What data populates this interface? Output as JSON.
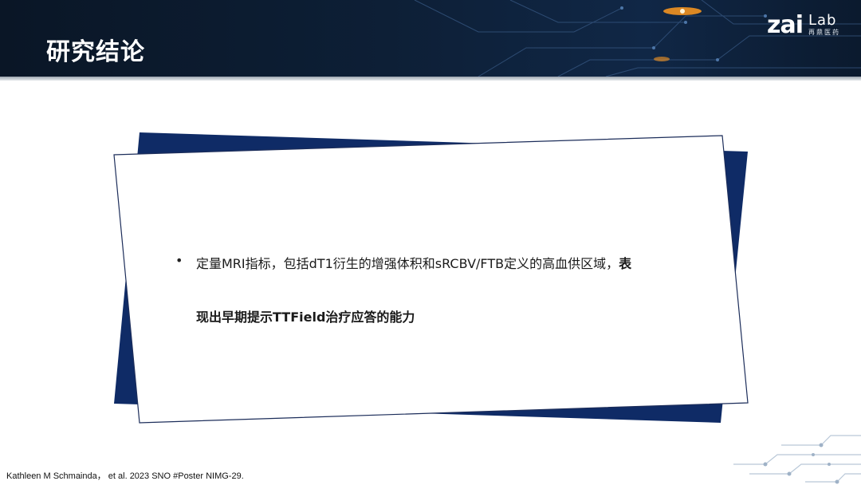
{
  "header": {
    "title": "研究结论",
    "logo": {
      "main": "zai",
      "sub": "Lab",
      "cn": "再鼎医药"
    }
  },
  "content": {
    "bullet": "•",
    "text_regular": "定量MRI指标，包括dT1衍生的增强体积和sRCBV/FTB定义的高血供区域，",
    "text_bold_1": "表",
    "text_bold_2": "现出早期提示TTField治疗应答的能力"
  },
  "footer": {
    "citation": "Kathleen M Schmainda， et al. 2023 SNO #Poster NIMG-29."
  },
  "colors": {
    "header_bg": "#0d1f36",
    "accent_orange": "#ff9a1f",
    "card_navy": "#0f2b66",
    "card_border": "#1c2d5a"
  }
}
